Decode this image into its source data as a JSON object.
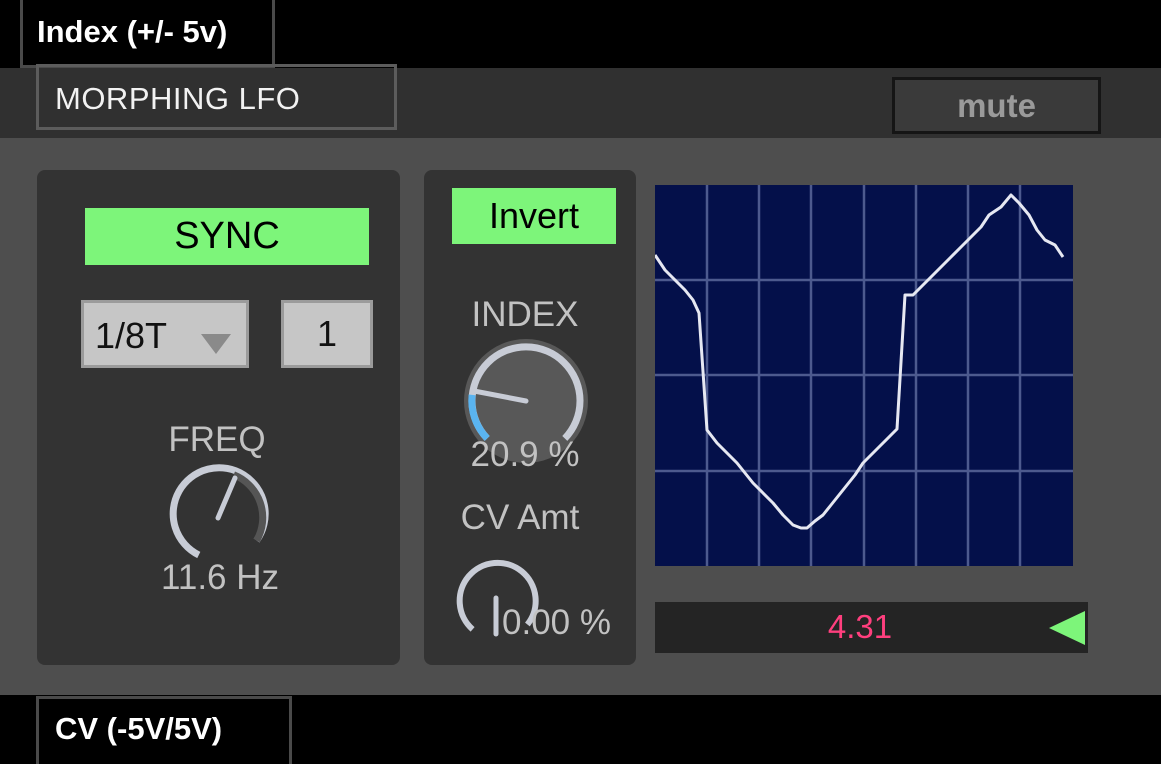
{
  "top_label": "Index (+/- 5v)",
  "device_title": "MORPHING LFO",
  "mute_label": "mute",
  "left_panel": {
    "sync_label": "SYNC",
    "rate_selected": "1/8T",
    "rate_number": "1",
    "freq_label": "FREQ",
    "freq_value": "11.6 Hz"
  },
  "mid_panel": {
    "invert_label": "Invert",
    "index_label": "INDEX",
    "index_value": "20.9 %",
    "index_fraction": 0.209,
    "cv_amt_label": "CV Amt",
    "cv_amt_value": "0.00 %",
    "cv_amt_fraction": 0.0
  },
  "output_value": "4.31",
  "bottom_label": "CV (-5V/5V)",
  "colors": {
    "accent_green": "#7df57a",
    "value_pink": "#ff3f7e",
    "scope_bg": "#04104a",
    "grid_line": "#4d5a8e",
    "knob_blue": "#5ab4f0"
  },
  "icons": {
    "rate_dropdown": "triangle-down-icon",
    "play": "triangle-left-icon"
  }
}
